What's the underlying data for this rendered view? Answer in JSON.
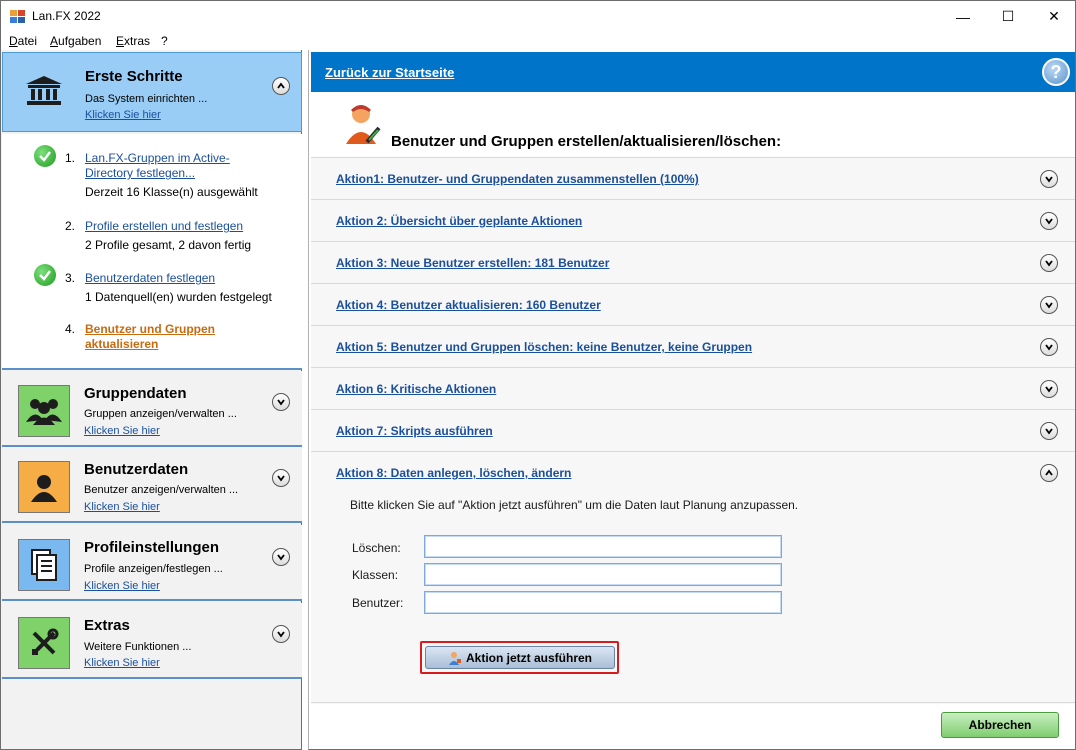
{
  "window": {
    "title": "Lan.FX 2022",
    "minimize": "—",
    "maximize": "☐",
    "close": "✕"
  },
  "menubar": {
    "items": [
      {
        "first": "D",
        "rest": "atei"
      },
      {
        "first": "A",
        "rest": "ufgaben"
      },
      {
        "first": "E",
        "rest": "xtras"
      },
      {
        "first": "?",
        "rest": ""
      }
    ]
  },
  "sidebar": {
    "active_section": {
      "title": "Erste Schritte",
      "subtitle": "Das System einrichten ...",
      "link": "Klicken Sie hier"
    },
    "steps": [
      {
        "num": "1.",
        "label_l1": "Lan.FX-Gruppen im Active-",
        "label_l2": "Directory festlegen...",
        "info": "Derzeit 16 Klasse(n) ausgewählt",
        "done": true
      },
      {
        "num": "2.",
        "label_l1": "Profile erstellen und festlegen",
        "label_l2": "",
        "info": "2 Profile gesamt, 2 davon fertig",
        "done": true
      },
      {
        "num": "3.",
        "label_l1": "Benutzerdaten festlegen",
        "label_l2": "",
        "info": "1 Datenquell(en) wurden festgelegt",
        "done": false
      },
      {
        "num": "4.",
        "label_l1": "Benutzer und Gruppen",
        "label_l2": "aktualisieren",
        "info": "",
        "done": false
      }
    ],
    "sections": [
      {
        "title": "Gruppendaten",
        "subtitle": "Gruppen anzeigen/verwalten ...",
        "link": "Klicken Sie hier",
        "icon": "group-icon"
      },
      {
        "title": "Benutzerdaten",
        "subtitle": "Benutzer anzeigen/verwalten ...",
        "link": "Klicken Sie hier",
        "icon": "user-icon"
      },
      {
        "title": "Profileinstellungen",
        "subtitle": "Profile anzeigen/festlegen ...",
        "link": "Klicken Sie hier",
        "icon": "document-icon"
      },
      {
        "title": "Extras",
        "subtitle": "Weitere Funktionen ...",
        "link": "Klicken Sie hier",
        "icon": "tools-icon"
      }
    ]
  },
  "main": {
    "back_link": "Zurück zur Startseite",
    "help": "?",
    "heading": "Benutzer und Gruppen erstellen/aktualisieren/löschen:",
    "actions": [
      "Aktion1: Benutzer- und Gruppendaten zusammenstellen (100%)",
      "Aktion 2: Übersicht über geplante Aktionen",
      "Aktion 3: Neue Benutzer erstellen: 181 Benutzer",
      "Aktion 4: Benutzer aktualisieren: 160 Benutzer",
      "Aktion 5: Benutzer und Gruppen löschen: keine Benutzer, keine Gruppen",
      "Aktion 6: Kritische Aktionen",
      "Aktion 7: Skripts ausführen",
      "Aktion 8: Daten anlegen, löschen, ändern"
    ],
    "instruction": "Bitte klicken Sie auf \"Aktion jetzt ausführen\" um die Daten laut Planung anzupassen.",
    "fields": [
      {
        "label": "Löschen:",
        "value": ""
      },
      {
        "label": "Klassen:",
        "value": ""
      },
      {
        "label": "Benutzer:",
        "value": ""
      }
    ],
    "execute_button": "Aktion jetzt ausführen",
    "cancel_button": "Abbrechen"
  },
  "colors": {
    "header_blue": "#0074c8",
    "active_section": "#99cdf5",
    "link": "#1a4f9c",
    "current_step": "#c86a10",
    "highlight_red": "#d61c1c",
    "cancel_green": "#7fce6f"
  }
}
